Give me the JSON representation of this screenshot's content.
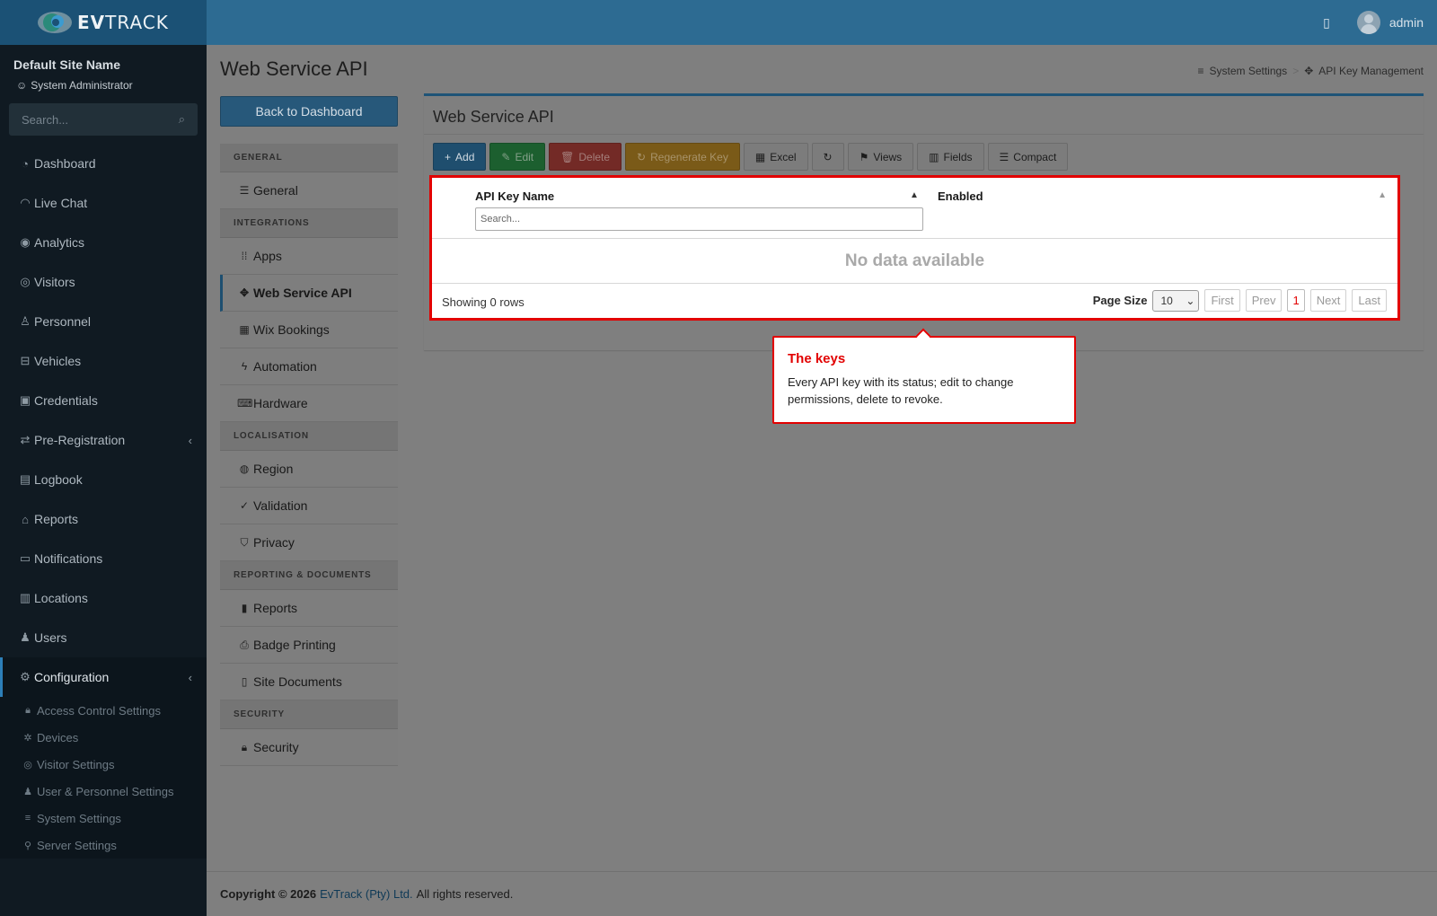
{
  "header": {
    "brand_prefix": "EV",
    "brand_suffix": "TRACK",
    "user": "admin"
  },
  "sidebar": {
    "site_name": "Default Site Name",
    "role": "System Administrator",
    "search_placeholder": "Search...",
    "items": [
      {
        "label": "Dashboard",
        "icon": "dashboard-icon"
      },
      {
        "label": "Live Chat",
        "icon": "headset-icon"
      },
      {
        "label": "Analytics",
        "icon": "analytics-icon"
      },
      {
        "label": "Visitors",
        "icon": "eye-icon"
      },
      {
        "label": "Personnel",
        "icon": "personnel-icon"
      },
      {
        "label": "Vehicles",
        "icon": "car-icon"
      },
      {
        "label": "Credentials",
        "icon": "id-card-icon"
      },
      {
        "label": "Pre-Registration",
        "icon": "arrows-icon"
      },
      {
        "label": "Logbook",
        "icon": "book-icon"
      },
      {
        "label": "Reports",
        "icon": "chart-icon"
      },
      {
        "label": "Notifications",
        "icon": "chat-icon"
      },
      {
        "label": "Locations",
        "icon": "map-icon"
      },
      {
        "label": "Users",
        "icon": "users-icon"
      },
      {
        "label": "Configuration",
        "icon": "gear-icon"
      }
    ],
    "sub_items": [
      {
        "label": "Access Control Settings",
        "icon": "lock-icon"
      },
      {
        "label": "Devices",
        "icon": "device-icon"
      },
      {
        "label": "Visitor Settings",
        "icon": "eye-icon"
      },
      {
        "label": "User & Personnel Settings",
        "icon": "users-icon"
      },
      {
        "label": "System Settings",
        "icon": "sliders-icon"
      },
      {
        "label": "Server Settings",
        "icon": "server-icon"
      }
    ]
  },
  "page": {
    "title": "Web Service API",
    "breadcrumb": [
      "System Settings",
      "API Key Management"
    ],
    "back_label": "Back to Dashboard"
  },
  "settings_menu": {
    "sections": [
      {
        "title": "GENERAL",
        "items": [
          "General"
        ]
      },
      {
        "title": "INTEGRATIONS",
        "items": [
          "Apps",
          "Web Service API",
          "Wix Bookings",
          "Automation",
          "Hardware"
        ]
      },
      {
        "title": "LOCALISATION",
        "items": [
          "Region",
          "Validation",
          "Privacy"
        ]
      },
      {
        "title": "REPORTING & DOCUMENTS",
        "items": [
          "Reports",
          "Badge Printing",
          "Site Documents"
        ]
      },
      {
        "title": "SECURITY",
        "items": [
          "Security"
        ]
      }
    ],
    "active": "Web Service API"
  },
  "panel": {
    "title": "Web Service API",
    "toolbar": {
      "add": "Add",
      "edit": "Edit",
      "delete": "Delete",
      "regenerate": "Regenerate Key",
      "excel": "Excel",
      "views": "Views",
      "fields": "Fields",
      "compact": "Compact"
    },
    "table": {
      "col_name": "API Key Name",
      "col_enabled": "Enabled",
      "search_placeholder": "Search...",
      "empty": "No data available",
      "showing": "Showing 0 rows",
      "page_size_label": "Page Size",
      "page_size": "10",
      "pager": {
        "first": "First",
        "prev": "Prev",
        "current": "1",
        "next": "Next",
        "last": "Last"
      }
    }
  },
  "tooltip": {
    "title": "The keys",
    "body": "Every API key with its status; edit to change permissions, delete to revoke."
  },
  "footer": {
    "copyright": "Copyright © 2026",
    "company": "EvTrack (Pty) Ltd.",
    "rights": "All rights reserved."
  },
  "colors": {
    "header": "#2d6b92",
    "sidebar": "#101a22",
    "highlight": "#e20000"
  }
}
